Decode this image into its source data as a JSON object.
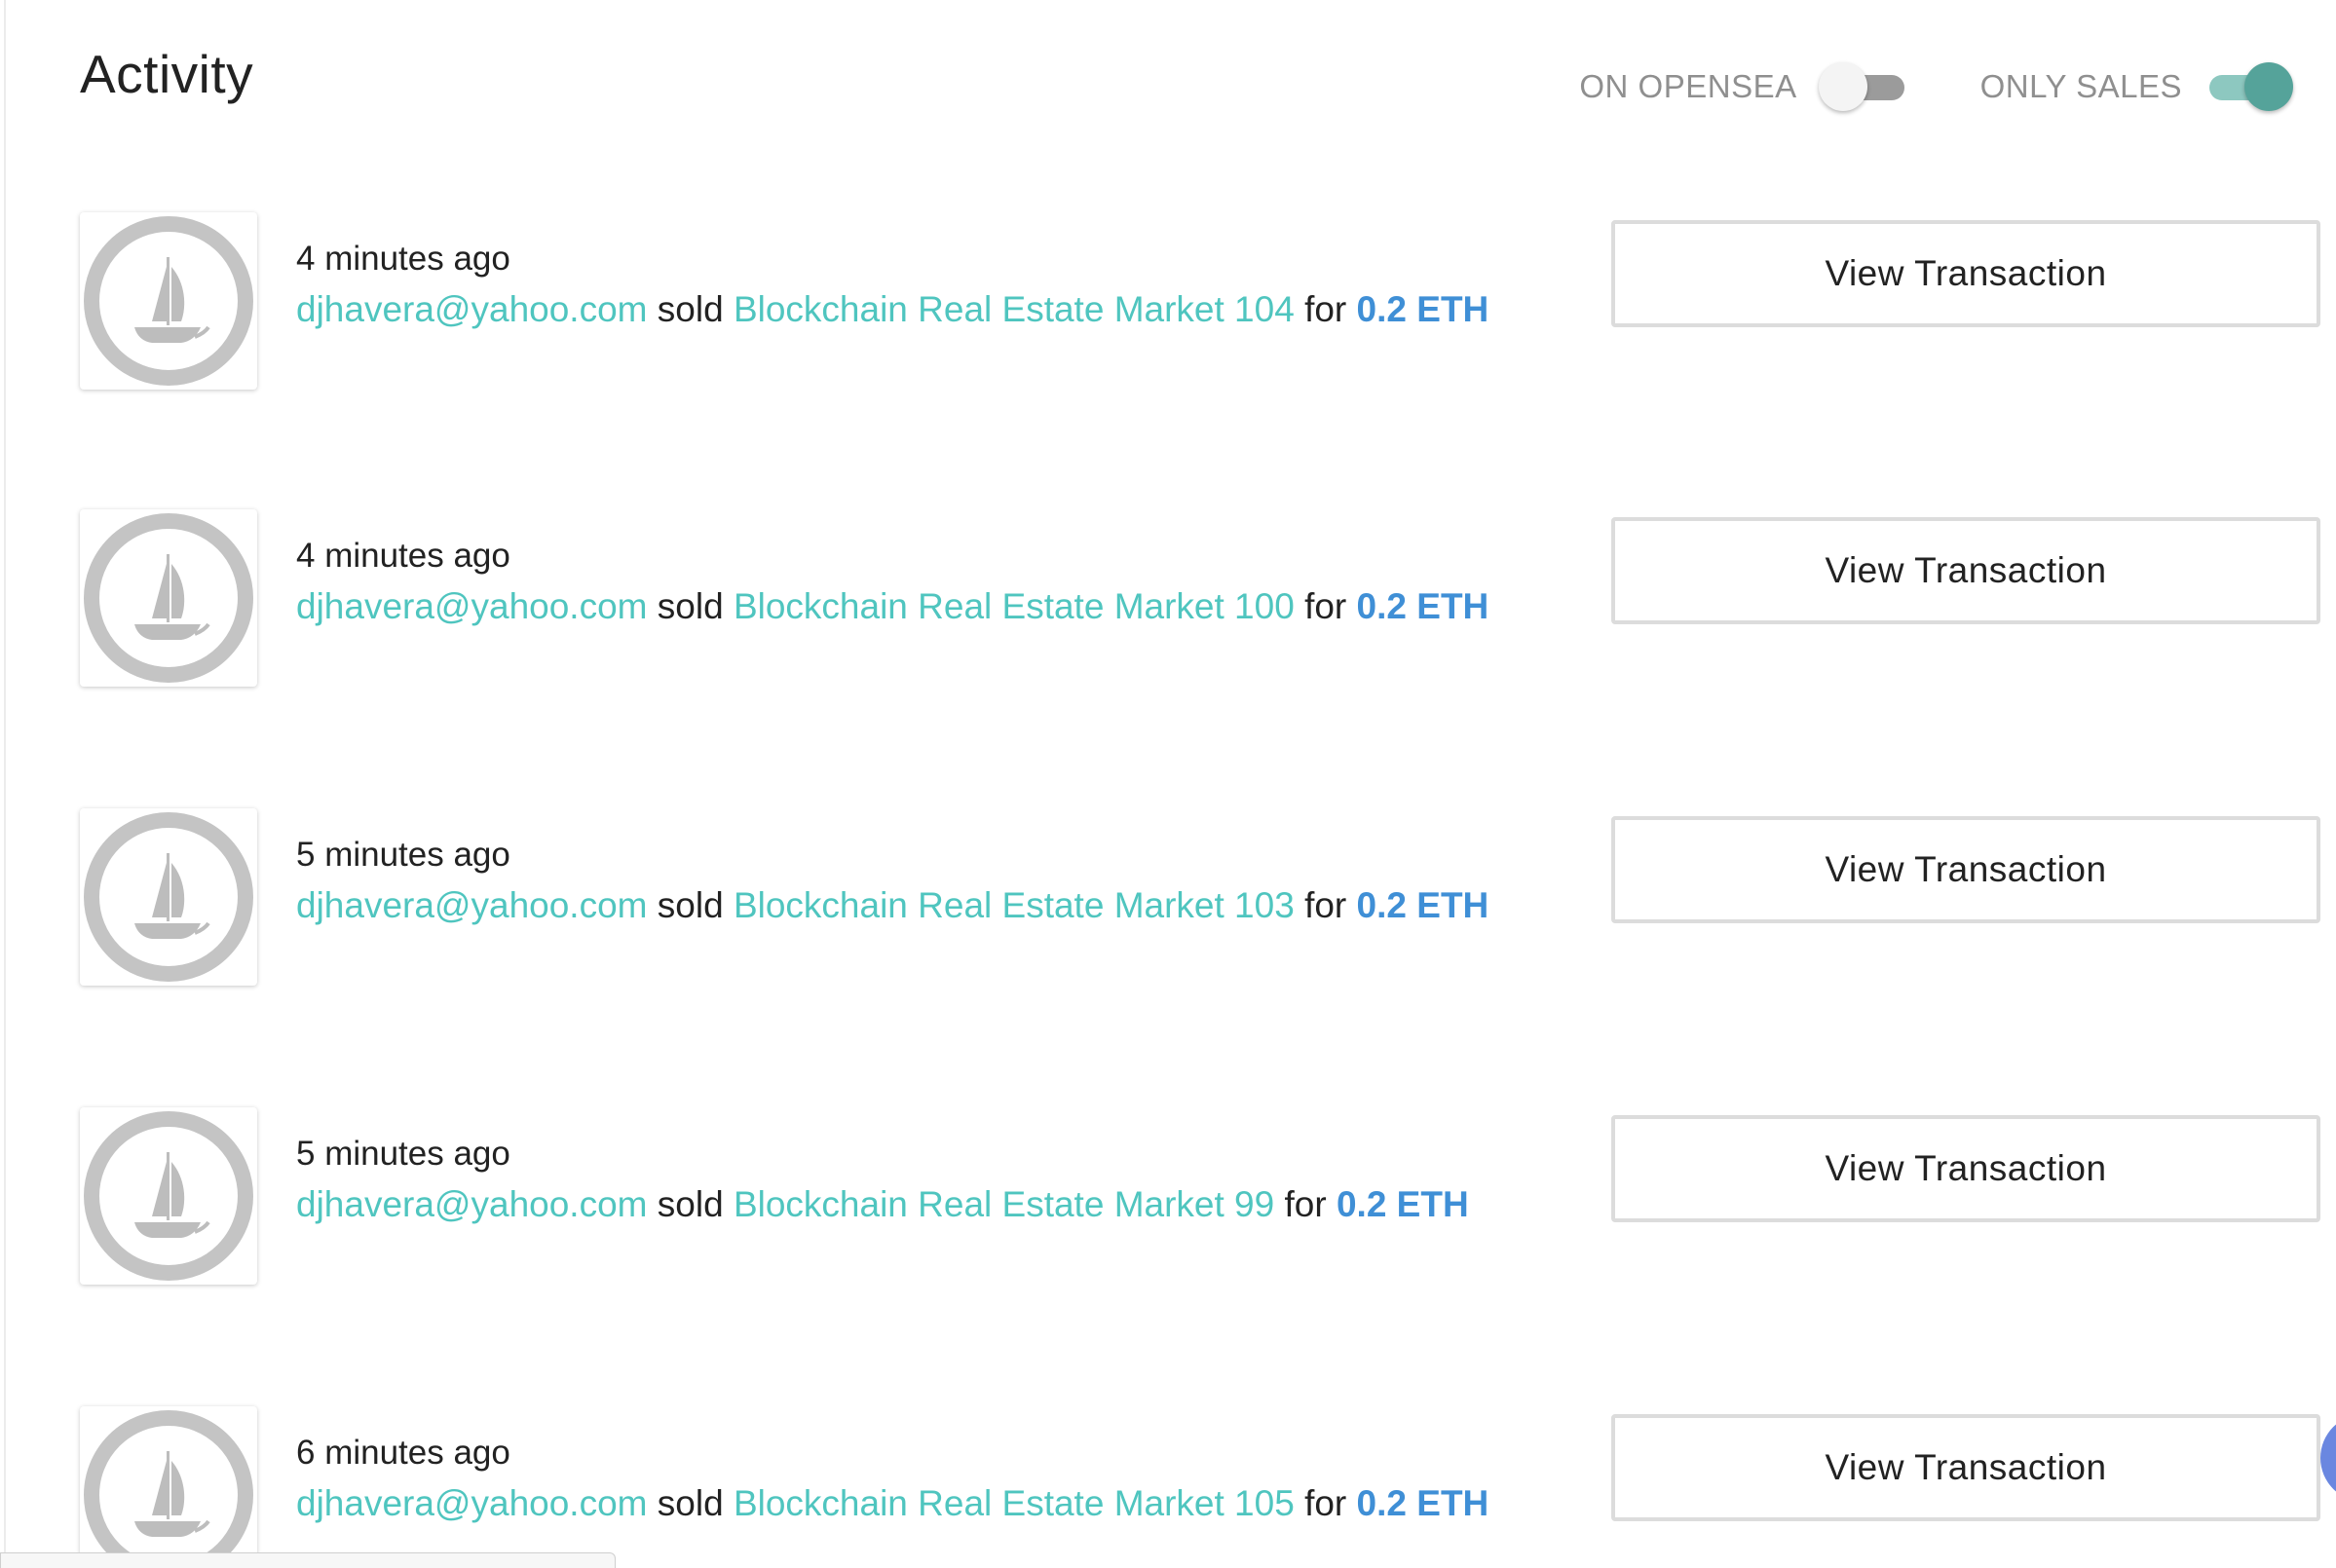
{
  "header": {
    "title": "Activity",
    "toggles": [
      {
        "label": "ON OPENSEA",
        "checked": false
      },
      {
        "label": "ONLY SALES",
        "checked": true
      }
    ]
  },
  "colors": {
    "link": "#4fc5bf",
    "price": "#3f8fd6",
    "toggle_on_knob": "#55a39a",
    "toggle_on_track": "#8dc8c0",
    "toggle_off_track": "#9b9b9b"
  },
  "activity": [
    {
      "time": "4 minutes ago",
      "user": "djhavera@yahoo.com",
      "verb": "sold",
      "item": "Blockchain Real Estate Market 104",
      "connector": "for",
      "price": "0.2 ETH",
      "button": "View Transaction",
      "icon": "opensea-ship-icon"
    },
    {
      "time": "4 minutes ago",
      "user": "djhavera@yahoo.com",
      "verb": "sold",
      "item": "Blockchain Real Estate Market 100",
      "connector": "for",
      "price": "0.2 ETH",
      "button": "View Transaction",
      "icon": "opensea-ship-icon"
    },
    {
      "time": "5 minutes ago",
      "user": "djhavera@yahoo.com",
      "verb": "sold",
      "item": "Blockchain Real Estate Market 103",
      "connector": "for",
      "price": "0.2 ETH",
      "button": "View Transaction",
      "icon": "opensea-ship-icon"
    },
    {
      "time": "5 minutes ago",
      "user": "djhavera@yahoo.com",
      "verb": "sold",
      "item": "Blockchain Real Estate Market 99",
      "connector": "for",
      "price": "0.2 ETH",
      "button": "View Transaction",
      "icon": "opensea-ship-icon"
    },
    {
      "time": "6 minutes ago",
      "user": "djhavera@yahoo.com",
      "verb": "sold",
      "item": "Blockchain Real Estate Market 105",
      "connector": "for",
      "price": "0.2 ETH",
      "button": "View Transaction",
      "icon": "opensea-ship-icon"
    }
  ]
}
